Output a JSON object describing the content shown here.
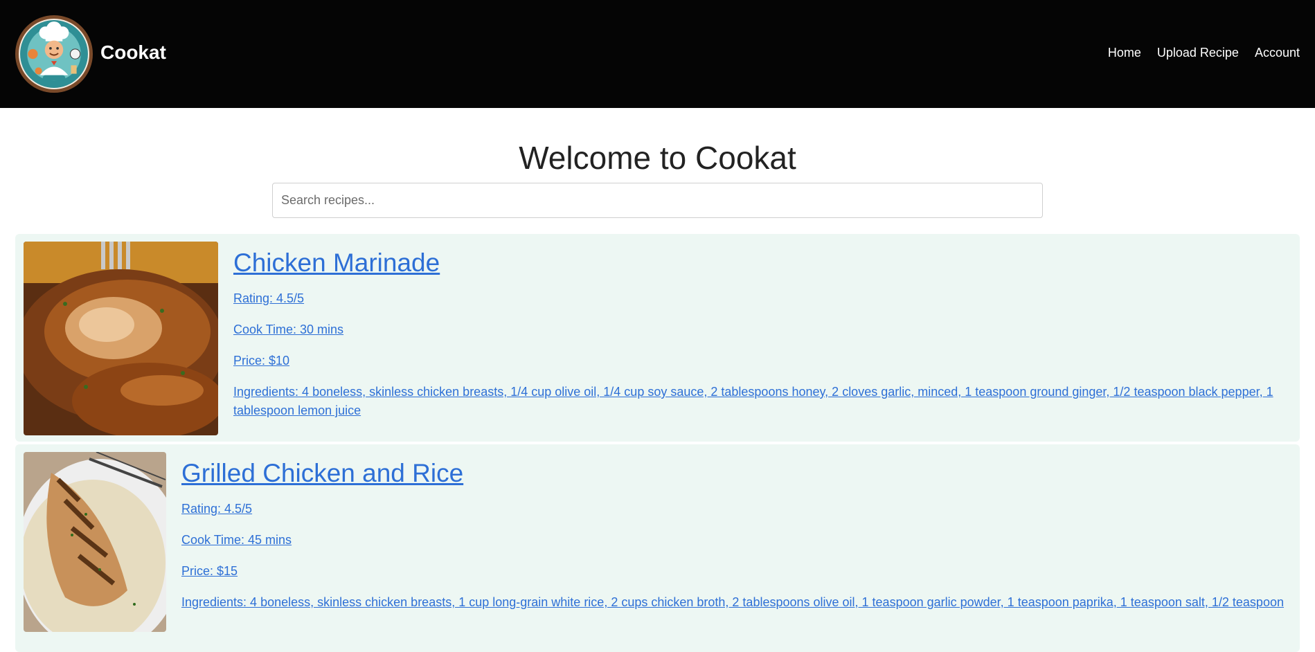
{
  "header": {
    "brand": "Cookat",
    "nav": [
      "Home",
      "Upload Recipe",
      "Account"
    ]
  },
  "main": {
    "title": "Welcome to Cookat",
    "search": {
      "placeholder": "Search recipes...",
      "value": ""
    }
  },
  "recipes": [
    {
      "title": "Chicken Marinade",
      "rating": "Rating: 4.5/5",
      "cook_time": "Cook Time: 30 mins",
      "price": "Price: $10",
      "ingredients": "Ingredients: 4 boneless, skinless chicken breasts, 1/4 cup olive oil, 1/4 cup soy sauce, 2 tablespoons honey, 2 cloves garlic, minced, 1 teaspoon ground ginger, 1/2 teaspoon black pepper, 1 tablespoon lemon juice"
    },
    {
      "title": "Grilled Chicken and Rice",
      "rating": "Rating: 4.5/5",
      "cook_time": "Cook Time: 45 mins",
      "price": "Price: $15",
      "ingredients": "Ingredients: 4 boneless, skinless chicken breasts, 1 cup long-grain white rice, 2 cups chicken broth, 2 tablespoons olive oil, 1 teaspoon garlic powder, 1 teaspoon paprika, 1 teaspoon salt, 1/2 teaspoon"
    }
  ],
  "colors": {
    "header_bg": "#050505",
    "card_bg": "#edf7f3",
    "link": "#2d6fd6"
  }
}
